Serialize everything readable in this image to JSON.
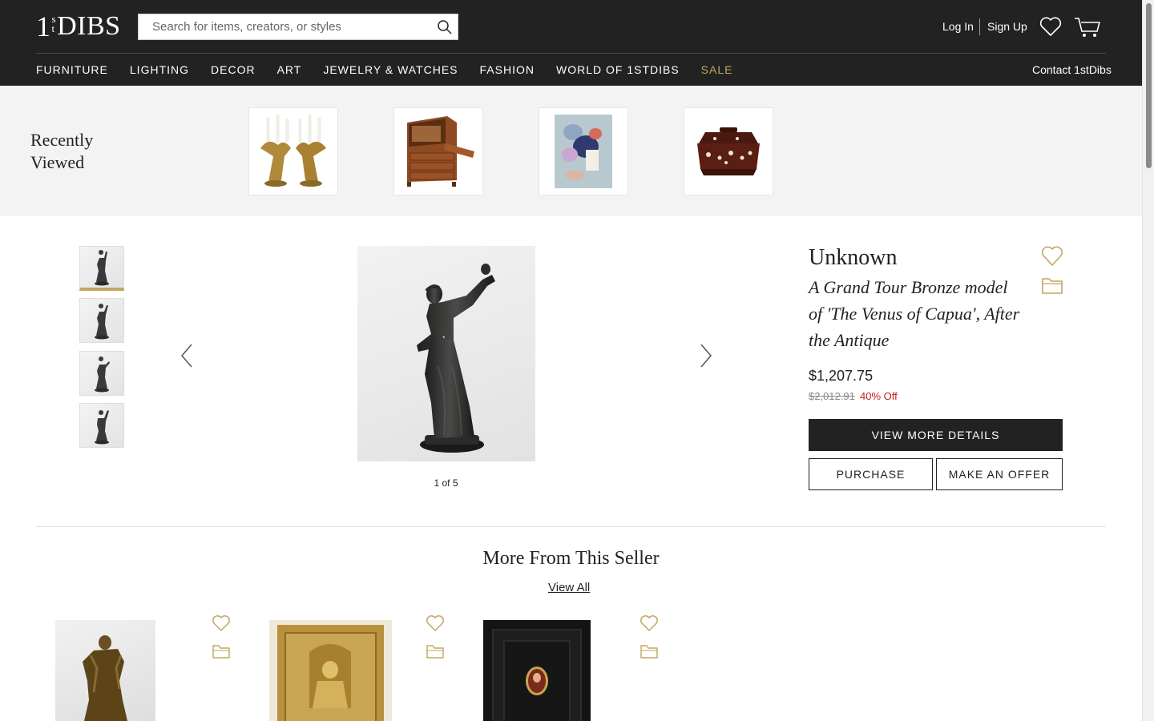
{
  "header": {
    "logo": {
      "one": "1",
      "s": "s",
      "t": "t",
      "dibs": "DIBS"
    },
    "search_placeholder": "Search for items, creators, or styles",
    "login": "Log In",
    "signup": "Sign Up",
    "nav": [
      "FURNITURE",
      "LIGHTING",
      "DECOR",
      "ART",
      "JEWELRY & WATCHES",
      "FASHION",
      "WORLD OF 1STDIBS",
      "SALE"
    ],
    "contact": "Contact 1stDibs"
  },
  "recently_viewed": {
    "title_line1": "Recently",
    "title_line2": "Viewed",
    "items": [
      "candelabra",
      "bureau",
      "abstract-painting",
      "tea-caddy"
    ]
  },
  "product": {
    "creator": "Unknown",
    "title": "A Grand Tour Bronze model of 'The Venus of Capua', After the Antique",
    "price": "$1,207.75",
    "original_price": "$2,012.91",
    "discount": "40% Off",
    "image_counter": "1 of 5",
    "view_details": "VIEW MORE DETAILS",
    "purchase": "PURCHASE",
    "make_offer": "MAKE AN OFFER"
  },
  "more_from_seller": {
    "title": "More From This Seller",
    "view_all": "View All"
  },
  "colors": {
    "header_bg": "#222222",
    "accent_gold": "#c2a661",
    "sale_red": "#c41e1e"
  }
}
